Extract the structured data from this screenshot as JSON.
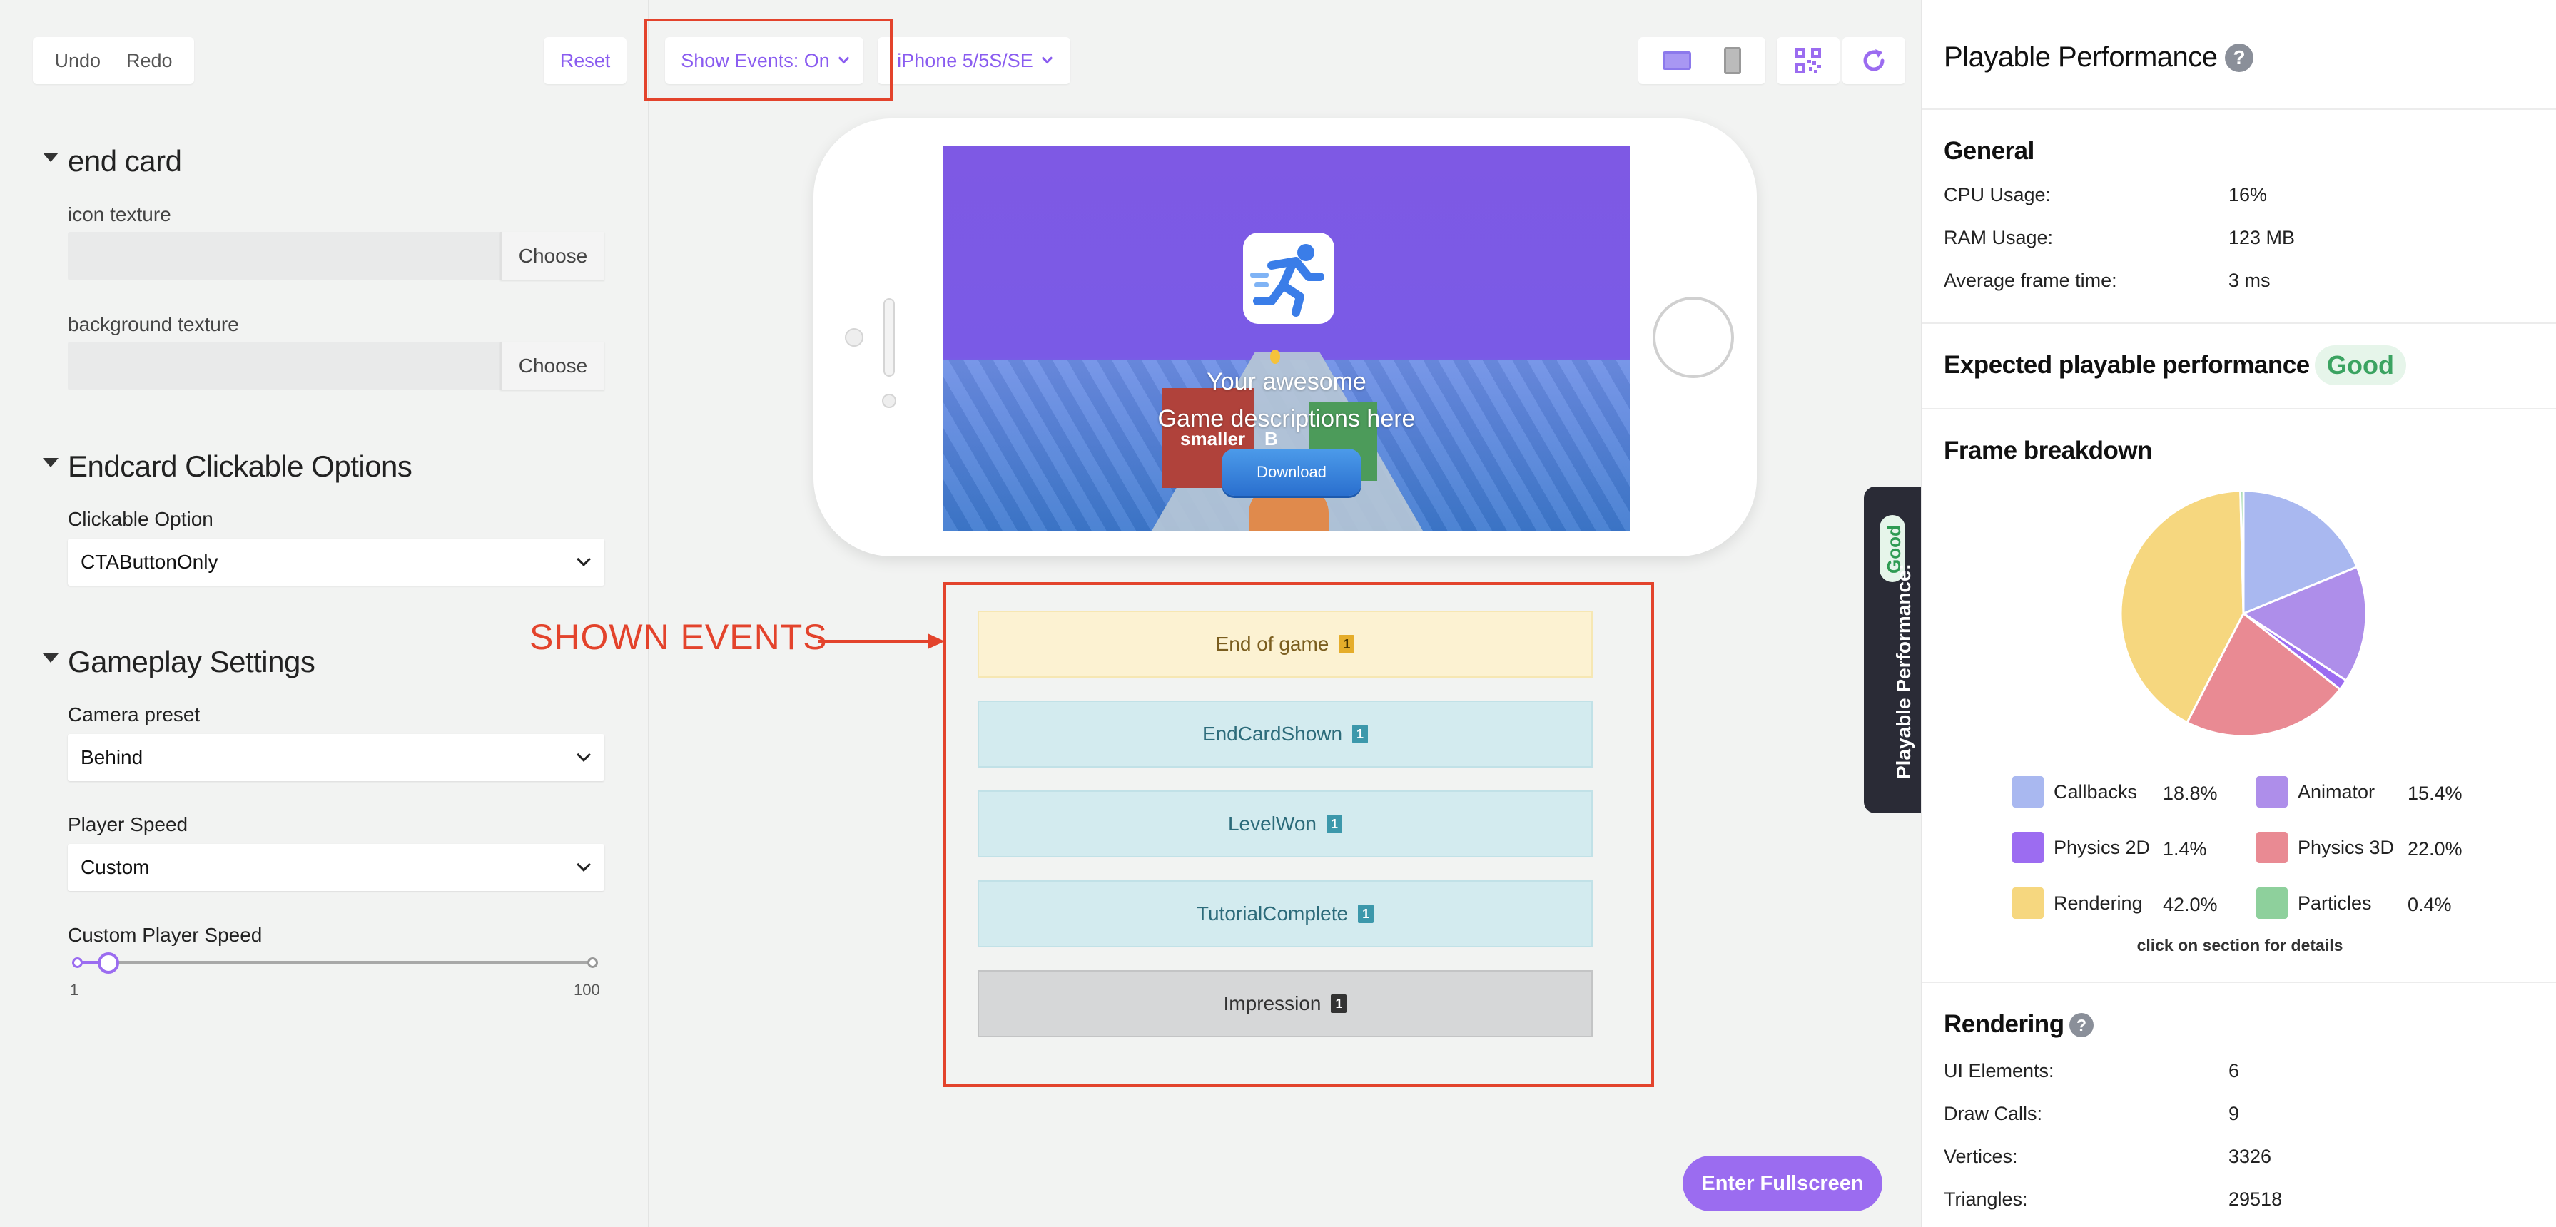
{
  "toolbar": {
    "undo": "Undo",
    "redo": "Redo",
    "reset": "Reset",
    "show_events": "Show Events: On",
    "device": "iPhone 5/5S/SE"
  },
  "left": {
    "end_card": {
      "title": "end card",
      "icon_texture_label": "icon texture",
      "background_texture_label": "background texture",
      "choose_label": "Choose"
    },
    "clickable": {
      "title": "Endcard Clickable Options",
      "option_label": "Clickable Option",
      "option_value": "CTAButtonOnly"
    },
    "gameplay": {
      "title": "Gameplay Settings",
      "camera_label": "Camera preset",
      "camera_value": "Behind",
      "speed_label": "Player Speed",
      "speed_value": "Custom",
      "custom_speed_label": "Custom Player Speed",
      "slider_min": "1",
      "slider_max": "100",
      "slider_value": 7
    }
  },
  "preview": {
    "description_line1": "Your awesome",
    "description_line2": "Game descriptions here",
    "tag_left": "smaller",
    "tag_right": "B",
    "download": "Download"
  },
  "annotation": {
    "shown_events": "SHOWN EVENTS"
  },
  "events": [
    {
      "label": "End of game",
      "count": "1",
      "style": "yellow"
    },
    {
      "label": "EndCardShown",
      "count": "1",
      "style": "cyan"
    },
    {
      "label": "LevelWon",
      "count": "1",
      "style": "cyan"
    },
    {
      "label": "TutorialComplete",
      "count": "1",
      "style": "cyan"
    },
    {
      "label": "Impression",
      "count": "1",
      "style": "gray"
    }
  ],
  "perf_tab": {
    "label": "Playable Performance:",
    "status": "Good"
  },
  "fullscreen": "Enter Fullscreen",
  "perf": {
    "title": "Playable Performance",
    "help": "?",
    "general": {
      "title": "General",
      "cpu_label": "CPU Usage:",
      "cpu_value": "16%",
      "ram_label": "RAM Usage:",
      "ram_value": "123 MB",
      "frame_label": "Average frame time:",
      "frame_value": "3 ms"
    },
    "expected": {
      "title": "Expected playable performance",
      "badge": "Good"
    },
    "frame_breakdown": {
      "title": "Frame breakdown",
      "hint": "click on section for details"
    },
    "rendering": {
      "title": "Rendering",
      "ui_label": "UI Elements:",
      "ui_value": "6",
      "draw_label": "Draw Calls:",
      "draw_value": "9",
      "vert_label": "Vertices:",
      "vert_value": "3326",
      "tri_label": "Triangles:",
      "tri_value": "29518"
    }
  },
  "chart_data": {
    "type": "pie",
    "slices": [
      {
        "name": "Callbacks",
        "value": 18.8,
        "pct": "18.8%",
        "color": "#a9b8f0"
      },
      {
        "name": "Animator",
        "value": 15.4,
        "pct": "15.4%",
        "color": "#ae8eea"
      },
      {
        "name": "Physics 2D",
        "value": 1.4,
        "pct": "1.4%",
        "color": "#9c6cf1"
      },
      {
        "name": "Physics 3D",
        "value": 22.0,
        "pct": "22.0%",
        "color": "#e98a93"
      },
      {
        "name": "Rendering",
        "value": 42.0,
        "pct": "42.0%",
        "color": "#f6d77f"
      },
      {
        "name": "Particles",
        "value": 0.4,
        "pct": "0.4%",
        "color": "#8ed09c"
      }
    ],
    "legend_placement": "bottom"
  }
}
